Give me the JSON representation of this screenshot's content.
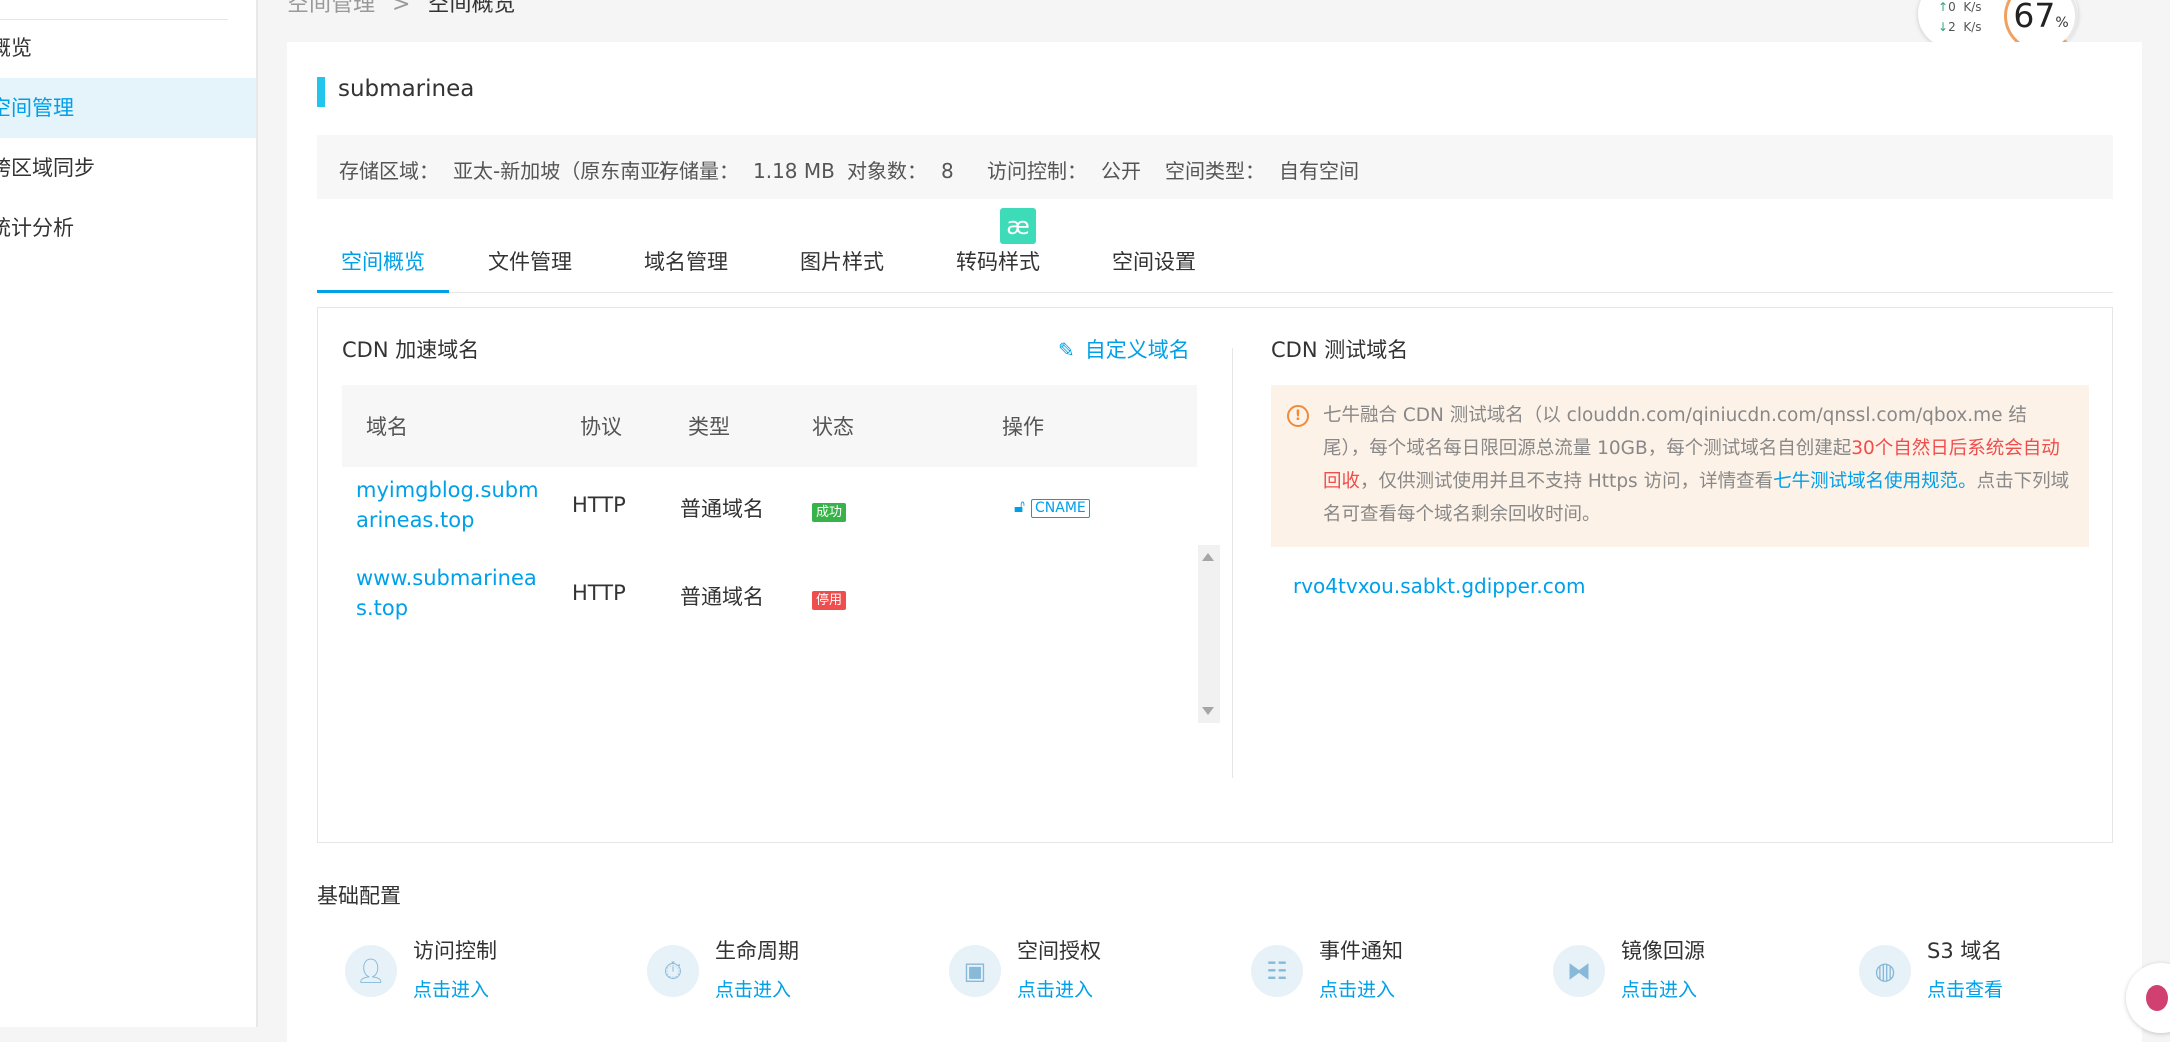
{
  "sidebar": {
    "items": [
      {
        "label": "概览",
        "active": false
      },
      {
        "label": "空间管理",
        "active": true
      },
      {
        "label": "跨区域同步",
        "active": false
      },
      {
        "label": "统计分析",
        "active": false
      }
    ]
  },
  "breadcrumb": {
    "parent": "空间管理",
    "separator": ">",
    "current": "空间概览"
  },
  "net_widget": {
    "up_value": "0",
    "up_unit": "K/s",
    "down_value": "2",
    "down_unit": "K/s",
    "percent": "67",
    "percent_sign": "%"
  },
  "bucket": {
    "name": "submarinea"
  },
  "info": {
    "region_label": "存储区域：",
    "region_value": "亚太-新加坡（原东南亚）",
    "storage_label": "存储量：",
    "storage_value": "1.18 MB",
    "objects_label": "对象数：",
    "objects_value": "8",
    "access_label": "访问控制：",
    "access_value": "公开",
    "type_label": "空间类型：",
    "type_value": "自有空间"
  },
  "tabs": [
    {
      "label": "空间概览",
      "active": true
    },
    {
      "label": "文件管理",
      "active": false
    },
    {
      "label": "域名管理",
      "active": false
    },
    {
      "label": "图片样式",
      "active": false
    },
    {
      "label": "转码样式",
      "active": false
    },
    {
      "label": "空间设置",
      "active": false
    }
  ],
  "floating_icon": {
    "glyph": "æ"
  },
  "cdn": {
    "title": "CDN 加速域名",
    "custom_domain_label": "自定义域名",
    "columns": [
      "域名",
      "协议",
      "类型",
      "状态",
      "操作"
    ],
    "rows": [
      {
        "domain": "myimgblog.submarineas.top",
        "protocol": "HTTP",
        "type": "普通域名",
        "status": "成功",
        "action": "CNAME"
      },
      {
        "domain": "www.submarineas.top",
        "protocol": "HTTP",
        "type": "普通域名",
        "status": "停用",
        "action": ""
      }
    ]
  },
  "test_cdn": {
    "title": "CDN 测试域名",
    "notice_part1": "七牛融合 CDN 测试域名（以 clouddn.com/qiniucdn.com/qnssl.com/qbox.me 结尾），每个域名每日限回源总流量 10GB，每个测试域名自创建起",
    "notice_red": "30个自然日后系统会自动回收",
    "notice_part2": "，仅供测试使用并且不支持 Https 访问，详情查看",
    "notice_link": "七牛测试域名使用规范。",
    "notice_part3": "点击下列域名可查看每个域名剩余回收时间。",
    "domain": "rvo4tvxou.sabkt.gdipper.com"
  },
  "basic_config": {
    "title": "基础配置",
    "items": [
      {
        "name": "访问控制",
        "link": "点击进入",
        "icon": "user-lock-icon"
      },
      {
        "name": "生命周期",
        "link": "点击进入",
        "icon": "lifecycle-icon"
      },
      {
        "name": "空间授权",
        "link": "点击进入",
        "icon": "box-lock-icon"
      },
      {
        "name": "事件通知",
        "link": "点击进入",
        "icon": "clipboard-icon"
      },
      {
        "name": "镜像回源",
        "link": "点击进入",
        "icon": "mirror-icon"
      },
      {
        "name": "S3 域名",
        "link": "点击查看",
        "icon": "globe-icon"
      }
    ]
  },
  "colors": {
    "accent": "#00a0e9",
    "title_bar": "#22c6ec",
    "success": "#37b34a",
    "danger": "#f04d4d",
    "notice_bg": "#fdf2e8"
  }
}
